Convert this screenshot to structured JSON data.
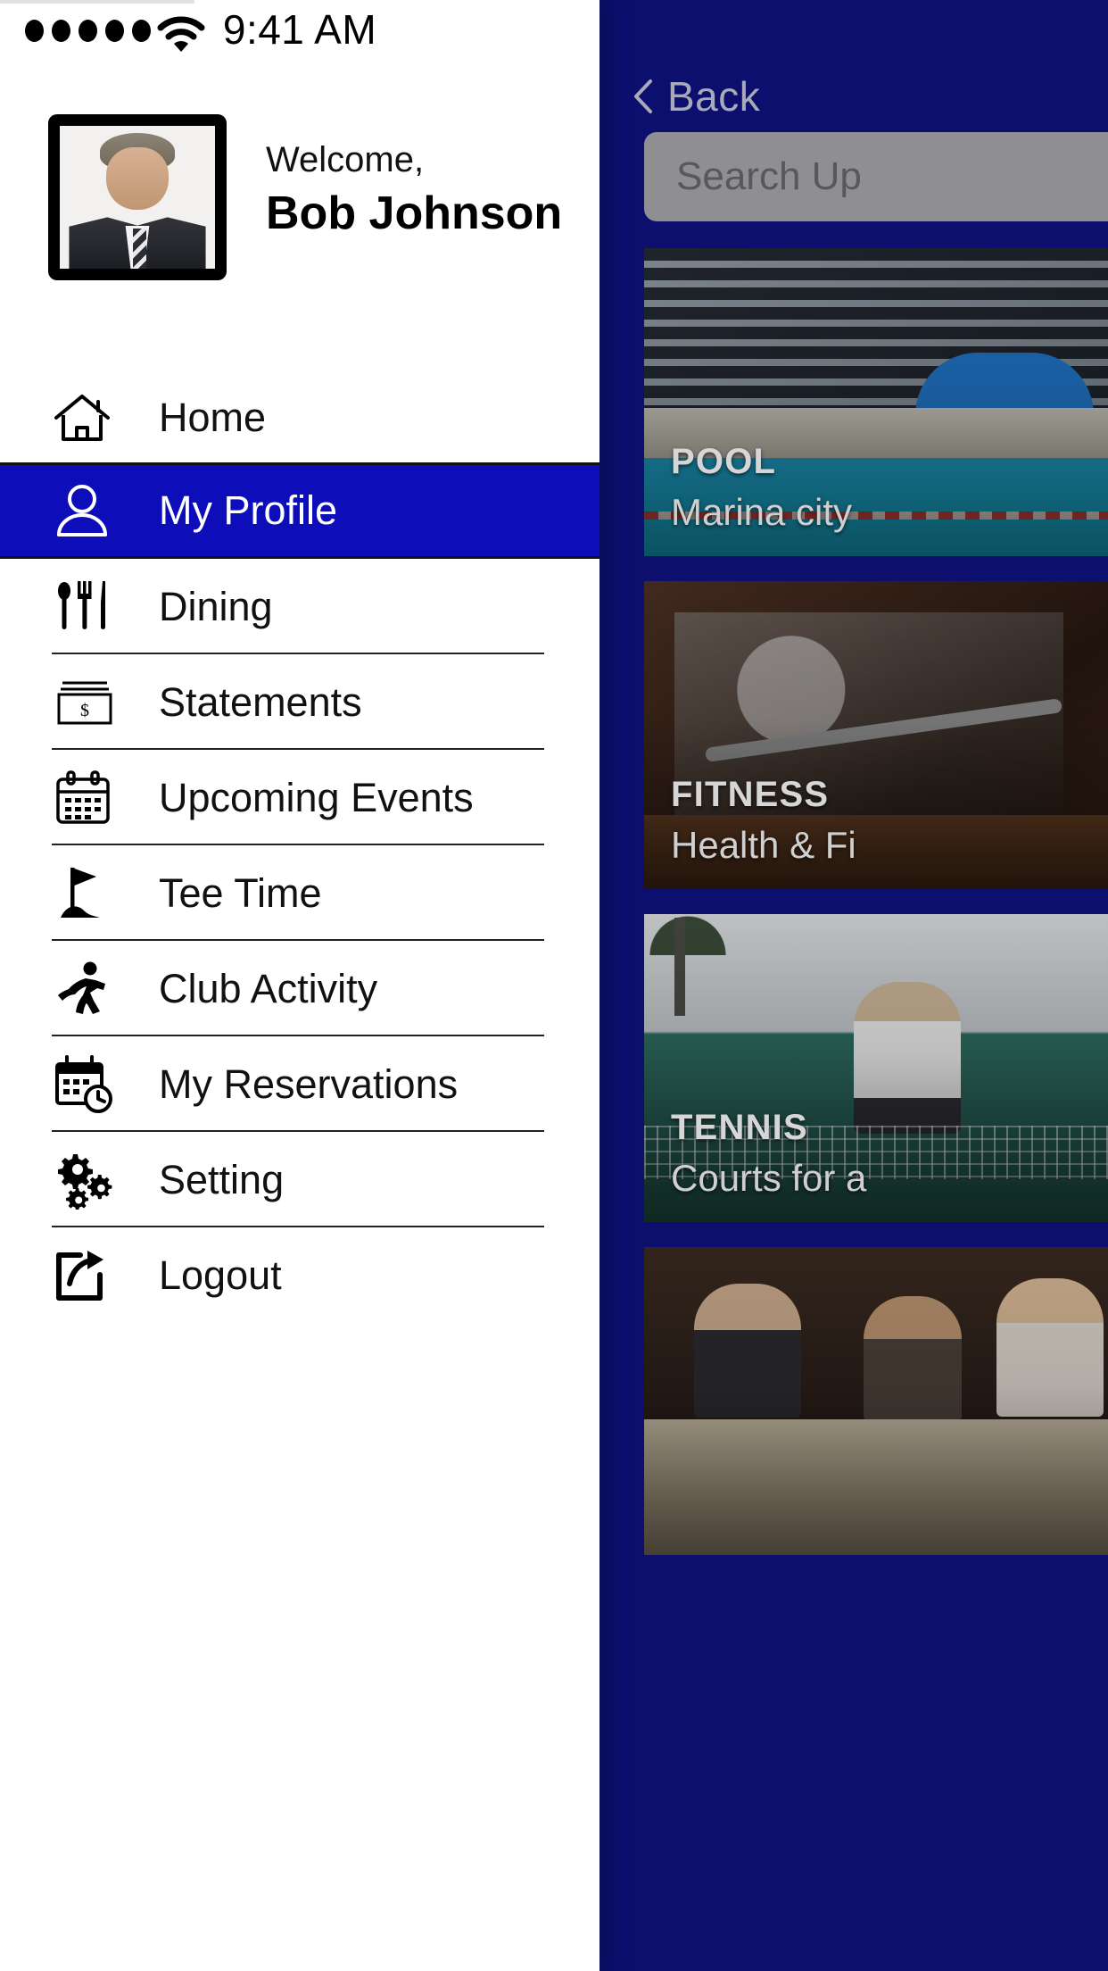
{
  "status_bar": {
    "signal_dots": 5,
    "wifi_icon": "wifi-icon",
    "time": "9:41 AM"
  },
  "profile": {
    "avatar_alt": "member-avatar",
    "welcome_label": "Welcome,",
    "user_name": "Bob Johnson"
  },
  "menu": {
    "items": [
      {
        "id": "home",
        "label": "Home",
        "icon": "home-icon",
        "active": false
      },
      {
        "id": "my-profile",
        "label": "My Profile",
        "icon": "person-icon",
        "active": true
      },
      {
        "id": "dining",
        "label": "Dining",
        "icon": "cutlery-icon",
        "active": false
      },
      {
        "id": "statements",
        "label": "Statements",
        "icon": "money-bill-icon",
        "active": false
      },
      {
        "id": "upcoming-events",
        "label": "Upcoming Events",
        "icon": "calendar-icon",
        "active": false
      },
      {
        "id": "tee-time",
        "label": "Tee Time",
        "icon": "golf-flag-icon",
        "active": false
      },
      {
        "id": "club-activity",
        "label": "Club Activity",
        "icon": "running-person-icon",
        "active": false
      },
      {
        "id": "my-reservations",
        "label": "My Reservations",
        "icon": "calendar-clock-icon",
        "active": false
      },
      {
        "id": "setting",
        "label": "Setting",
        "icon": "gears-icon",
        "active": false
      },
      {
        "id": "logout",
        "label": "Logout",
        "icon": "logout-arrow-icon",
        "active": false
      }
    ]
  },
  "app_screen": {
    "back_label": "Back",
    "back_icon": "chevron-left-icon",
    "search_placeholder": "Search Up",
    "cards": [
      {
        "category": "POOL",
        "title": "Marina city",
        "photo": "pool-photo"
      },
      {
        "category": "FITNESS",
        "title": "Health & Fi",
        "photo": "fitness-photo"
      },
      {
        "category": "TENNIS",
        "title": "Courts for a",
        "photo": "tennis-photo"
      },
      {
        "category": "",
        "title": "",
        "photo": "dining-photo"
      }
    ]
  },
  "colors": {
    "accent_blue": "#0d0dba",
    "app_navy": "#0c0f6e",
    "search_gray": "#8f8f93",
    "back_text": "#a9aab8"
  }
}
